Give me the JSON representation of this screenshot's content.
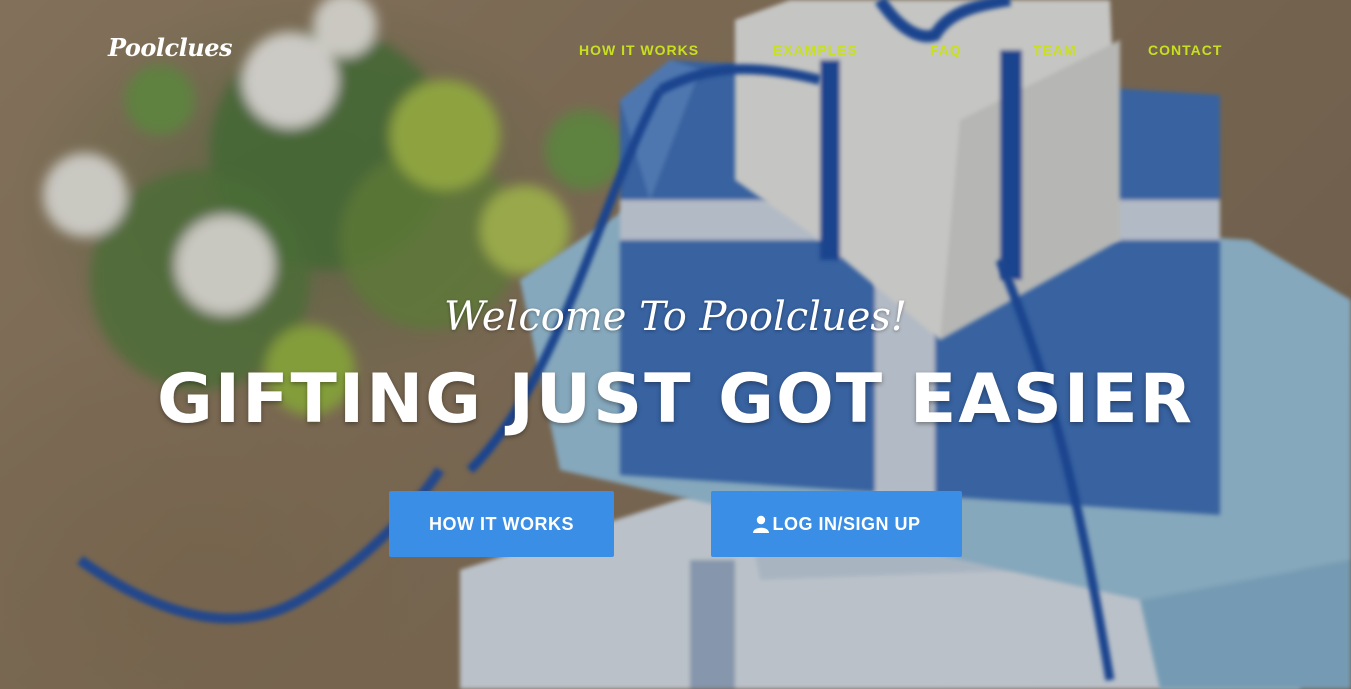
{
  "brand": {
    "name": "Poolclues"
  },
  "nav": {
    "items": [
      {
        "label": "HOW IT WORKS"
      },
      {
        "label": "EXAMPLES"
      },
      {
        "label": "FAQ"
      },
      {
        "label": "TEAM"
      },
      {
        "label": "CONTACT"
      }
    ]
  },
  "hero": {
    "welcome": "Welcome To Poolclues!",
    "headline": "GIFTING JUST GOT EASIER",
    "buttons": {
      "how_it_works": "HOW IT WORKS",
      "login": "LOG IN/SIGN UP"
    }
  },
  "icons": {
    "login_icon": "user-icon"
  },
  "colors": {
    "nav_link": "#c8e020",
    "button_bg": "#3a8ee6",
    "text": "#ffffff"
  }
}
